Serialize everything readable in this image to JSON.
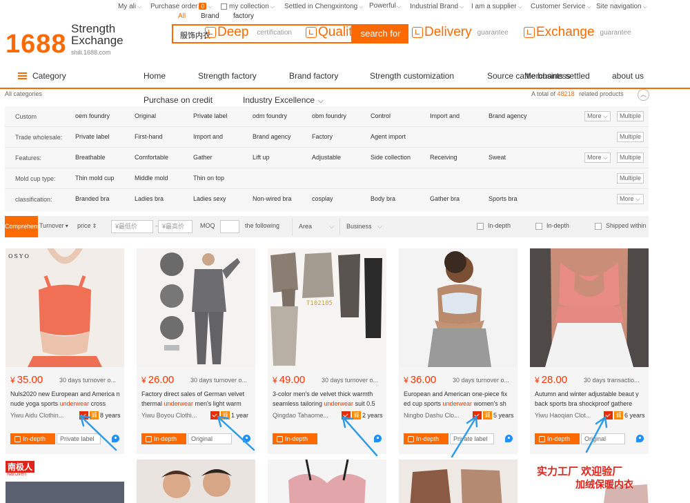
{
  "topbar": {
    "items": [
      "My ali",
      "Purchase order",
      "my collection",
      "Settled in Chengxintong",
      "Powerful business",
      "Industrial Brand",
      "I am a supplier",
      "Customer Service",
      "Site navigation"
    ],
    "order_badge": "0"
  },
  "header": {
    "logo_num": "1688",
    "logo_line1": "Strength",
    "logo_line2": "Exchange",
    "logo_domain": "shili.1688.com",
    "scopes": [
      "All",
      "Brand",
      "factory"
    ],
    "search_value": "服饰内衣",
    "search_button": "search for",
    "guarantees": [
      {
        "big": "Deep",
        "small": "certification"
      },
      {
        "big": "Quality",
        "small": ""
      },
      {
        "big": "Delivery",
        "small": "guarantee"
      },
      {
        "big": "Exchange",
        "small": "guarantee"
      }
    ]
  },
  "nav": {
    "category": "Category",
    "items": [
      "Home",
      "Strength factory",
      "Brand factory",
      "Strength customization",
      "Source cattle business",
      "Merchants settled",
      "about us"
    ],
    "sub_items": [
      "Purchase on credit",
      "Industry Excellence"
    ]
  },
  "breadcrumb": "All categories",
  "summary": {
    "prefix": "A total of",
    "count": "48218",
    "suffix": "related products"
  },
  "filters": [
    {
      "label": "Custom processing:",
      "options": [
        "oem foundry",
        "Original",
        "Private label",
        "odm foundry",
        "obm foundry",
        "Control",
        "Import and",
        "Brand agency"
      ],
      "more": "More",
      "multi": "Multiple choice"
    },
    {
      "label": "Trade wholesale:",
      "options": [
        "Private label",
        "First-hand",
        "Import and",
        "Brand agency",
        "Factory",
        "Agent import"
      ],
      "more": "",
      "multi": "Multiple choice"
    },
    {
      "label": "Features:",
      "options": [
        "Breathable",
        "Comfortable",
        "Gather",
        "Lift up",
        "Adjustable",
        "Side collection",
        "Receiving",
        "Sweat"
      ],
      "more": "More",
      "multi": "Multiple choice"
    },
    {
      "label": "Mold cup type:",
      "options": [
        "Thin mold cup",
        "Middle mold",
        "Thin on top"
      ],
      "more": "",
      "multi": "Multiple choice"
    },
    {
      "label": "classification:",
      "options": [
        "Branded bra",
        "Ladies bra",
        "Ladies sexy",
        "Non-wired bra",
        "cosplay",
        "Body bra",
        "Gather bra",
        "Sports bra"
      ],
      "more": "More",
      "multi": ""
    }
  ],
  "sortbar": {
    "active": "Comprehensive",
    "turnover": "Turnover",
    "price": "price",
    "min_price": "¥最低价",
    "max_price": "¥最高价",
    "moq": "MOQ",
    "following": "the following",
    "area": "Area",
    "business": "Business",
    "check1": "In-depth",
    "check2": "In-depth",
    "check3": "Shipped within"
  },
  "products": [
    {
      "price": "35.00",
      "turnover": "30 days turnover o...",
      "title_pre": "Nuls2020 new European and America n nude yoga sports ",
      "title_hl": "underwear",
      "title_post": " cross",
      "seller": "Yiwu Aidu Clothin...",
      "years": "8 years",
      "tag": "In-depth",
      "opt": "Private label",
      "brand": "OSYO"
    },
    {
      "price": "26.00",
      "turnover": "30 days turnover o...",
      "title_pre": "Factory direct sales of German velvet thermal ",
      "title_hl": "underwear",
      "title_post": " men's light warm",
      "seller": "Yiwu Boyou Clothi...",
      "years": "1 year",
      "tag": "In-depth",
      "opt": "Original",
      "brand": ""
    },
    {
      "price": "49.00",
      "turnover": "30 days turnover o...",
      "title_pre": "3-color men's de velvet thick warmth seamless tailoring ",
      "title_hl": "underwear",
      "title_post": " suit 0.5",
      "seller": "Qingdao Tahaome...",
      "years": "2 years",
      "tag": "In-depth",
      "opt": "",
      "brand": "T102105"
    },
    {
      "price": "36.00",
      "turnover": "30 days turnover o...",
      "title_pre": "European and American one-piece fix ed cup sports ",
      "title_hl": "underwear",
      "title_post": " women's sh",
      "seller": "Ningbo Dashu Clo...",
      "years": "5 years",
      "tag": "In-depth",
      "opt": "Private label",
      "brand": ""
    },
    {
      "price": "28.00",
      "turnover": "30 days transactio...",
      "title_pre": "Autumn and winter adjustable beaut y back sports bra shockproof gathere",
      "title_hl": "",
      "title_post": "",
      "seller": "Yiwu Haoqian Clot...",
      "years": "6 years",
      "tag": "In-depth",
      "opt": "Original",
      "brand": ""
    }
  ],
  "row2": {
    "brand1": "南极人",
    "brand1_sub": "NanJiren",
    "promo_line1": "实力工厂 欢迎验厂",
    "promo_line2": "加绒保暖内衣"
  },
  "colors": {
    "accent": "#ff6a00",
    "price": "#ff3300",
    "annotation": "#2d9be8"
  }
}
